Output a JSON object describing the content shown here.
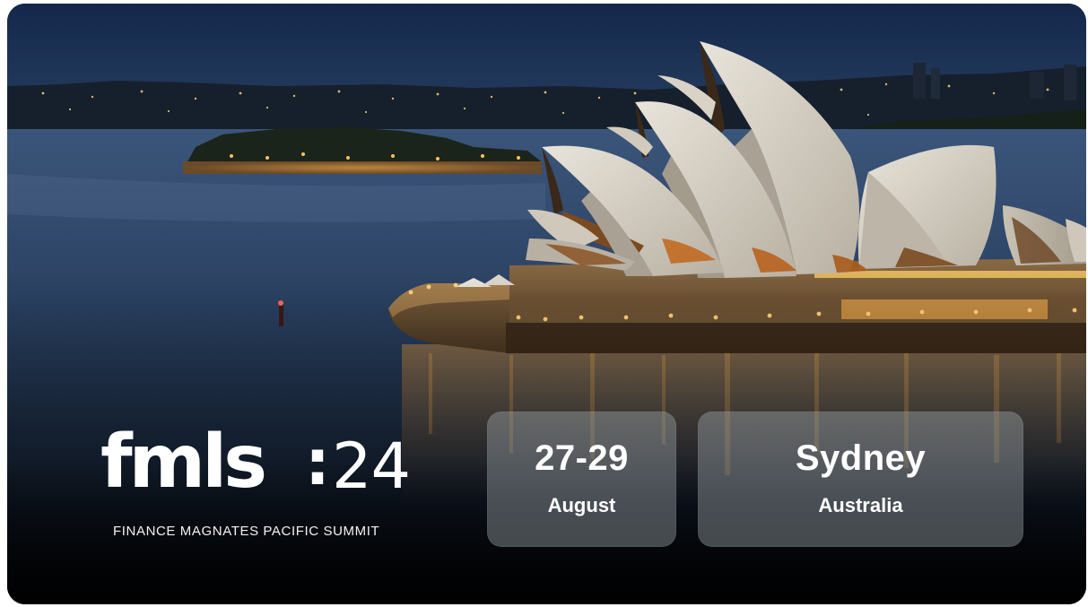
{
  "banner": {
    "logo": {
      "wordmark": "fmls",
      "separator": ":",
      "year": "24",
      "tagline": "FINANCE MAGNATES PACIFIC SUMMIT"
    },
    "date_box": {
      "main": "27-29",
      "sub": "August"
    },
    "location_box": {
      "main": "Sydney",
      "sub": "Australia"
    },
    "photo": {
      "subject": "sydney-opera-house-at-night"
    },
    "colors": {
      "sky": "#1a2d4f",
      "water": "#2c4466",
      "shell": "#d8d2c6",
      "light": "#ffb34d",
      "box": "#8f989c"
    }
  }
}
